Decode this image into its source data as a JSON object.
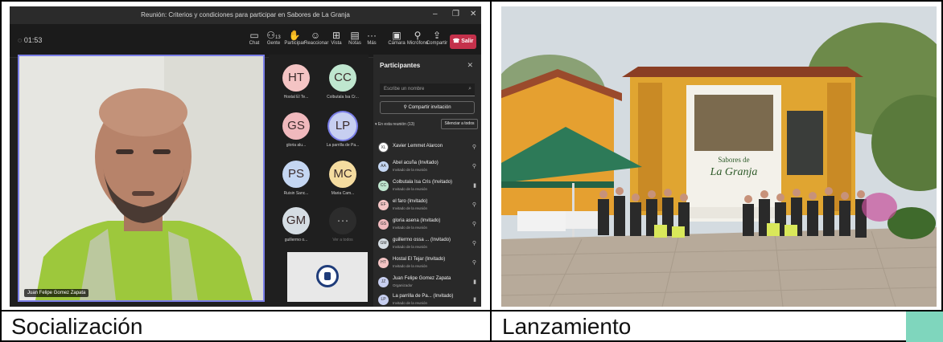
{
  "captions": {
    "left": "Socialización",
    "right": "Lanzamiento"
  },
  "teams": {
    "window_title": "Reunión: Criterios y condiciones para participar en Sabores de La Granja",
    "window_controls": [
      "–",
      "❐",
      "✕"
    ],
    "timer": "01:53",
    "toolbar": [
      {
        "label": "Chat",
        "icon": "chat-icon"
      },
      {
        "label": "Gente",
        "icon": "people-icon",
        "badge": "13"
      },
      {
        "label": "Participar",
        "icon": "raise-hand-icon"
      },
      {
        "label": "Reaccionar",
        "icon": "reaction-icon"
      },
      {
        "label": "Vista",
        "icon": "view-icon"
      },
      {
        "label": "Notas",
        "icon": "notes-icon"
      },
      {
        "label": "Más",
        "icon": "more-icon"
      },
      {
        "label": "Cámara",
        "icon": "camera-icon"
      },
      {
        "label": "Micrófono",
        "icon": "mic-icon"
      },
      {
        "label": "Compartir",
        "icon": "share-icon"
      }
    ],
    "leave_label": "Salir",
    "video_name": "Juan Felipe Gomez Zapata",
    "tiles": [
      {
        "initials": "HT",
        "name": "Hostal El Te...",
        "color": "#f4c4c4"
      },
      {
        "initials": "CC",
        "name": "Colbutala Isa Cr...",
        "color": "#bfe6cf"
      },
      {
        "initials": "GS",
        "name": "gloria alu...",
        "color": "#f0b9bd"
      },
      {
        "initials": "LP",
        "name": "La parrilla de Pa...",
        "color": "#c7cff0"
      },
      {
        "initials": "PS",
        "name": "Ruisin Sanc...",
        "color": "#c4d6f2"
      },
      {
        "initials": "MC",
        "name": "Maria Cam...",
        "color": "#f5dca0"
      },
      {
        "initials": "GM",
        "name": "guillermo o...",
        "color": "#d5dde3"
      },
      {
        "initials": "···",
        "name": "Ver a todos",
        "color": "#2c2c2c"
      }
    ],
    "panel": {
      "title": "Participantes",
      "search_placeholder": "Escribe un nombre",
      "invite_label": "Compartir invitación",
      "section_label": "En esta reunión (13)",
      "mute_all_label": "Silenciar a todos",
      "people": [
        {
          "initials": "XL",
          "name": "Xavier Lemmet Alarcon",
          "sub": "",
          "color": "#ffffff"
        },
        {
          "initials": "AA",
          "name": "Abel acuña (Invitado)",
          "sub": "Invitado de la reunión",
          "color": "#c4d6f2"
        },
        {
          "initials": "CC",
          "name": "Colbutala Isa Cris (Invitado)",
          "sub": "Invitado de la reunión",
          "color": "#bfe6cf"
        },
        {
          "initials": "EF",
          "name": "el faro (Invitado)",
          "sub": "Invitado de la reunión",
          "color": "#f4c4c4"
        },
        {
          "initials": "GS",
          "name": "gloria asena (Invitado)",
          "sub": "Invitado de la reunión",
          "color": "#f0b9bd"
        },
        {
          "initials": "GM",
          "name": "guillermo ossa ...  (Invitado)",
          "sub": "Invitado de la reunión",
          "color": "#d5dde3"
        },
        {
          "initials": "HT",
          "name": "Hostal El Tejar (Invitado)",
          "sub": "Invitado de la reunión",
          "color": "#f4c4c4"
        },
        {
          "initials": "JZ",
          "name": "Juan Felipe Gomez Zapata",
          "sub": "Organizador",
          "color": "#c7cff0"
        },
        {
          "initials": "LP",
          "name": "La parrilla de Pa...  (Invitado)",
          "sub": "Invitado de la reunión",
          "color": "#c7cff0"
        }
      ]
    }
  },
  "photo": {
    "sign_line1": "Sabores de",
    "sign_line2": "La Granja"
  }
}
